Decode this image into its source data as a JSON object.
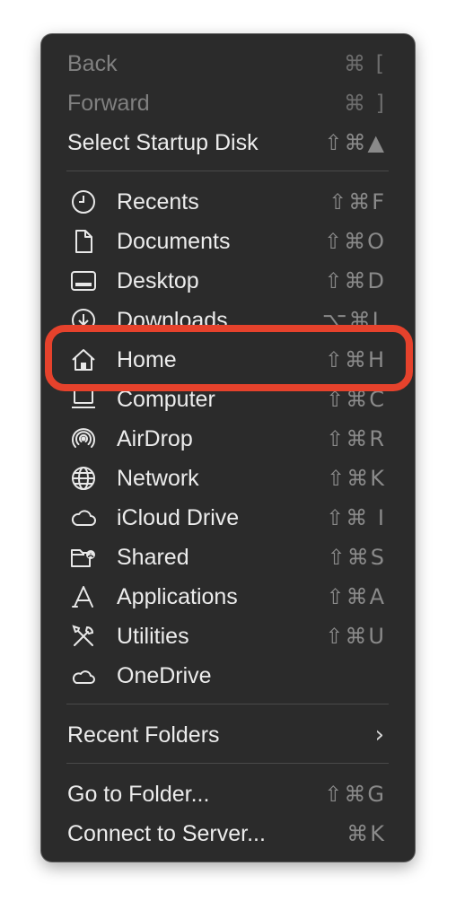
{
  "menu": {
    "back": {
      "label": "Back",
      "shortcut": "⌘ ["
    },
    "forward": {
      "label": "Forward",
      "shortcut": "⌘ ]"
    },
    "startup": {
      "label": "Select Startup Disk",
      "shortcut": "⇧⌘▲"
    },
    "places": [
      {
        "label": "Recents",
        "shortcut": "⇧⌘F",
        "icon": "clock-icon"
      },
      {
        "label": "Documents",
        "shortcut": "⇧⌘O",
        "icon": "document-icon"
      },
      {
        "label": "Desktop",
        "shortcut": "⇧⌘D",
        "icon": "desktop-icon"
      },
      {
        "label": "Downloads",
        "shortcut": "⌥⌘L",
        "icon": "download-icon"
      },
      {
        "label": "Home",
        "shortcut": "⇧⌘H",
        "icon": "house-icon"
      },
      {
        "label": "Computer",
        "shortcut": "⇧⌘C",
        "icon": "computer-icon"
      },
      {
        "label": "AirDrop",
        "shortcut": "⇧⌘R",
        "icon": "airdrop-icon"
      },
      {
        "label": "Network",
        "shortcut": "⇧⌘K",
        "icon": "globe-icon"
      },
      {
        "label": "iCloud Drive",
        "shortcut": "⇧⌘ I",
        "icon": "cloud-icon"
      },
      {
        "label": "Shared",
        "shortcut": "⇧⌘S",
        "icon": "shared-folder-icon"
      },
      {
        "label": "Applications",
        "shortcut": "⇧⌘A",
        "icon": "applications-icon"
      },
      {
        "label": "Utilities",
        "shortcut": "⇧⌘U",
        "icon": "utilities-icon"
      },
      {
        "label": "OneDrive",
        "shortcut": "",
        "icon": "cloud-icon"
      }
    ],
    "recent_folders": {
      "label": "Recent Folders"
    },
    "go_to_folder": {
      "label": "Go to Folder...",
      "shortcut": "⇧⌘G"
    },
    "connect": {
      "label": "Connect to Server...",
      "shortcut": "⌘K"
    }
  },
  "highlight_color": "#e6422c"
}
